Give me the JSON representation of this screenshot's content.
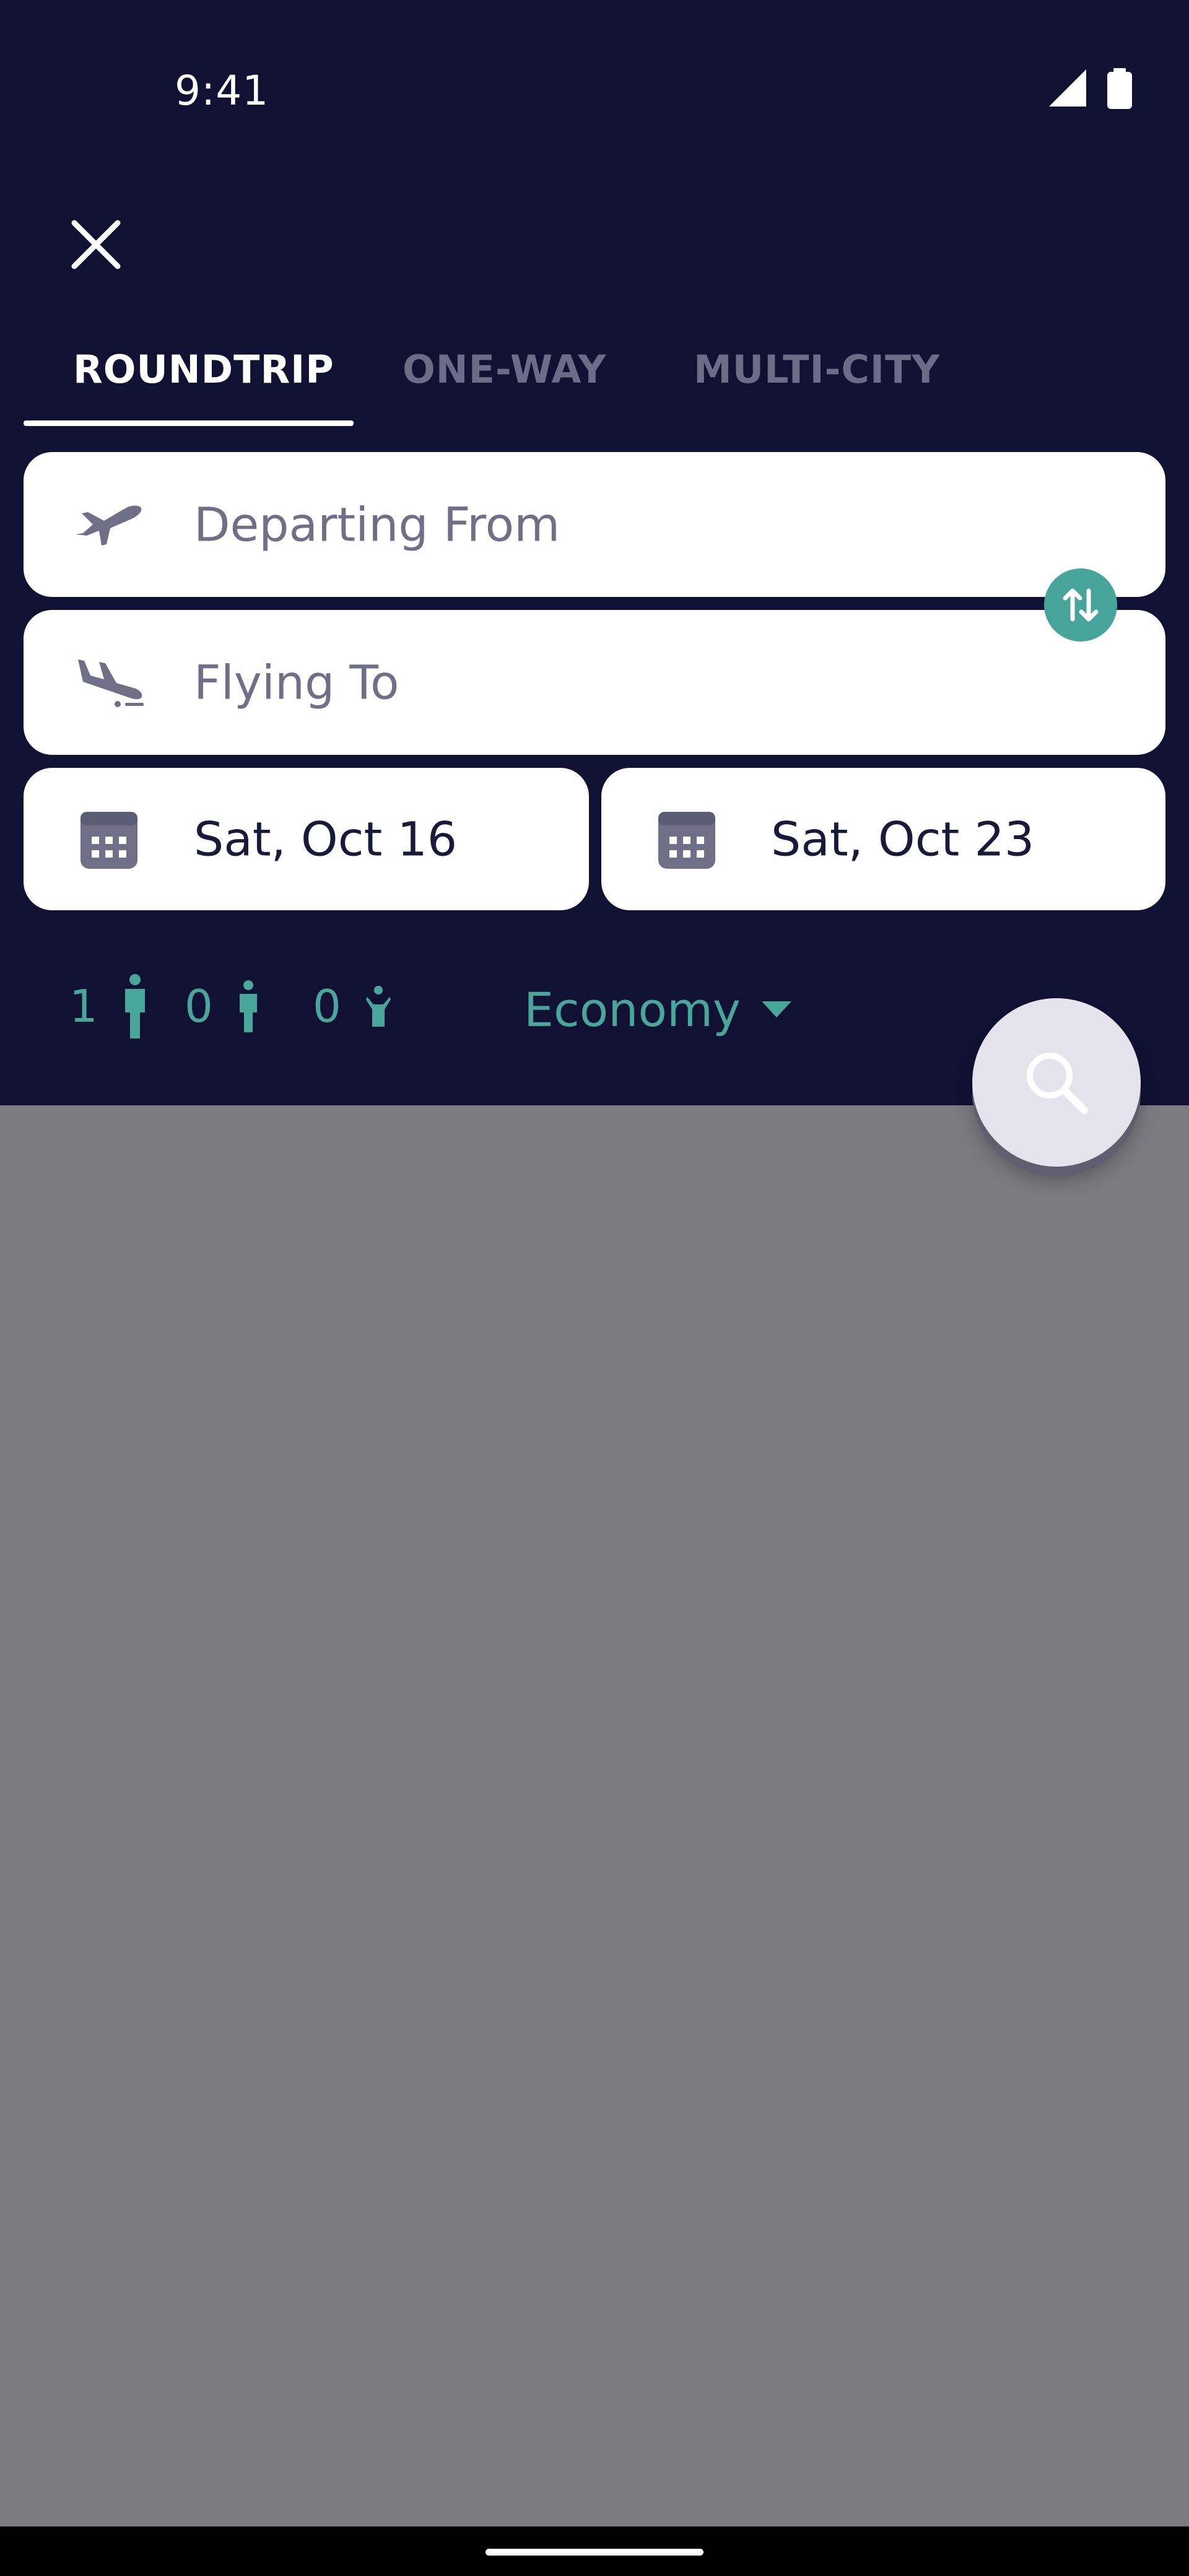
{
  "status_bar": {
    "time": "9:41"
  },
  "tabs": [
    {
      "label": "ROUNDTRIP",
      "active": true
    },
    {
      "label": "ONE-WAY",
      "active": false
    },
    {
      "label": "MULTI-CITY",
      "active": false
    }
  ],
  "search_form": {
    "origin_placeholder": "Departing From",
    "destination_placeholder": "Flying To",
    "depart_date": "Sat, Oct 16",
    "return_date": "Sat, Oct 23"
  },
  "travelers": {
    "adults": "1",
    "children": "0",
    "infants": "0"
  },
  "cabin_class": "Economy",
  "colors": {
    "header_background": "#111133",
    "accent": "#47a49a",
    "overlay": "#7a7b80",
    "field_background": "#ffffff"
  },
  "icons": {
    "close": "close-icon",
    "departure": "airplane-takeoff-icon",
    "arrival": "airplane-landing-icon",
    "swap": "swap-vertical-icon",
    "calendar": "calendar-icon",
    "adult": "adult-icon",
    "child": "child-icon",
    "infant": "infant-icon",
    "dropdown": "caret-down-icon",
    "search": "search-icon"
  }
}
